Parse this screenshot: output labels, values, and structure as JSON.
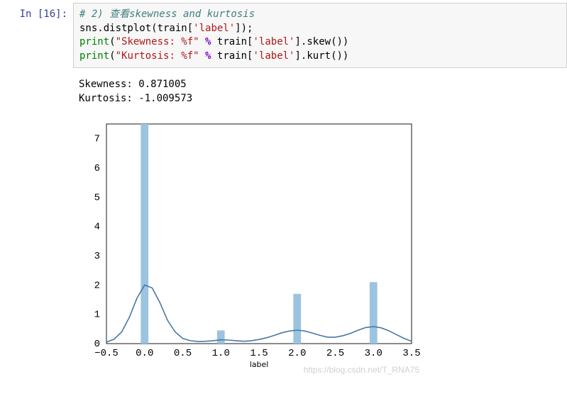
{
  "cell": {
    "prompt": "In  [16]:",
    "code": {
      "l1_comment": "# 2) 查看skewness and kurtosis",
      "l2a": "sns.distplot(train[",
      "l2b": "'label'",
      "l2c": "]);",
      "l3a": "print",
      "l3b": "(",
      "l3c": "\"Skewness: %f\"",
      "l3d": " % ",
      "l3e": "train[",
      "l3f": "'label'",
      "l3g": "].skew())",
      "l4a": "print",
      "l4b": "(",
      "l4c": "\"Kurtosis: %f\"",
      "l4d": " % ",
      "l4e": "train[",
      "l4f": "'label'",
      "l4g": "].kurt())"
    }
  },
  "output": {
    "line1": "Skewness: 0.871005",
    "line2": "Kurtosis: -1.009573"
  },
  "watermark": "https://blog.csdn.net/T_RNA75",
  "chart_data": {
    "type": "distplot",
    "xlabel": "label",
    "xlim": [
      -0.5,
      3.5
    ],
    "ylim": [
      0,
      7.5
    ],
    "xticks": [
      -0.5,
      0.0,
      0.5,
      1.0,
      1.5,
      2.0,
      2.5,
      3.0,
      3.5
    ],
    "yticks": [
      0,
      1,
      2,
      3,
      4,
      5,
      6,
      7
    ],
    "bars": [
      {
        "x": 0.0,
        "height": 7.5,
        "width": 0.1
      },
      {
        "x": 1.0,
        "height": 0.45,
        "width": 0.1
      },
      {
        "x": 2.0,
        "height": 1.7,
        "width": 0.1
      },
      {
        "x": 3.0,
        "height": 2.1,
        "width": 0.1
      }
    ],
    "kde": {
      "x": [
        -0.5,
        -0.4,
        -0.3,
        -0.2,
        -0.1,
        0.0,
        0.1,
        0.2,
        0.3,
        0.4,
        0.5,
        0.6,
        0.7,
        0.8,
        0.9,
        1.0,
        1.1,
        1.2,
        1.3,
        1.4,
        1.5,
        1.6,
        1.7,
        1.8,
        1.9,
        2.0,
        2.1,
        2.2,
        2.3,
        2.4,
        2.5,
        2.6,
        2.7,
        2.8,
        2.9,
        3.0,
        3.1,
        3.2,
        3.3,
        3.4,
        3.5
      ],
      "y": [
        0.05,
        0.15,
        0.4,
        0.9,
        1.55,
        2.0,
        1.9,
        1.4,
        0.8,
        0.4,
        0.18,
        0.1,
        0.07,
        0.08,
        0.1,
        0.13,
        0.12,
        0.1,
        0.08,
        0.1,
        0.14,
        0.2,
        0.28,
        0.37,
        0.43,
        0.46,
        0.43,
        0.36,
        0.28,
        0.22,
        0.22,
        0.27,
        0.35,
        0.46,
        0.55,
        0.58,
        0.54,
        0.44,
        0.31,
        0.18,
        0.08
      ]
    }
  }
}
